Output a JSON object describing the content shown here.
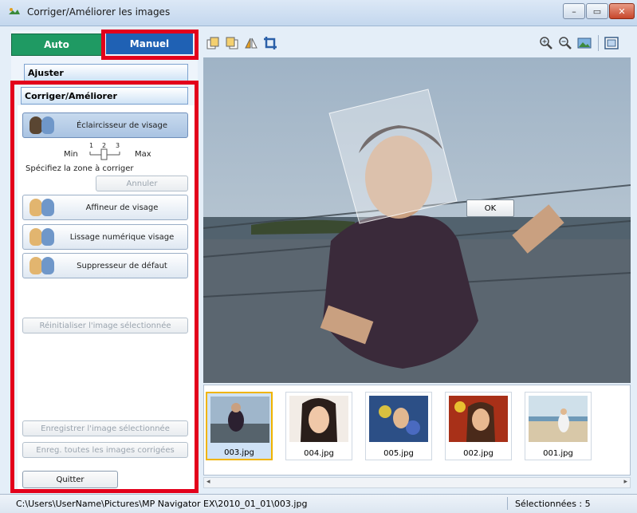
{
  "window": {
    "title": "Corriger/Améliorer les images",
    "controls": [
      "–",
      "▭",
      "✕"
    ]
  },
  "mode_tabs": {
    "auto": "Auto",
    "manual": "Manuel"
  },
  "sections": {
    "adjust": "Ajuster",
    "correct": "Corriger/Améliorer"
  },
  "tools": {
    "face_brightener": "Éclaircisseur de visage",
    "slider_min": "Min",
    "slider_max": "Max",
    "slider_ticks": [
      "1",
      "2",
      "3"
    ],
    "slider_value": 2,
    "specify_area": "Spécifiez la zone à corriger",
    "cancel": "Annuler",
    "face_sharpener": "Affineur de visage",
    "digital_face_smoothing": "Lissage numérique visage",
    "blemish_remover": "Suppresseur de défaut",
    "reset_selected": "Réinitialiser l'image sélectionnée",
    "save_selected": "Enregistrer l'image sélectionnée",
    "save_all": "Enreg. toutes les images corrigées",
    "quit": "Quitter"
  },
  "toolbar": {
    "left_icons": [
      "rotate-left-icon",
      "rotate-right-icon",
      "mirror-icon",
      "crop-icon"
    ],
    "right_icons": [
      "zoom-in-icon",
      "zoom-out-icon",
      "fit-image-icon",
      "full-screen-icon"
    ]
  },
  "preview": {
    "ok_label": "OK"
  },
  "thumbnails": [
    {
      "name": "003.jpg",
      "selected": true
    },
    {
      "name": "004.jpg",
      "selected": false
    },
    {
      "name": "005.jpg",
      "selected": false
    },
    {
      "name": "002.jpg",
      "selected": false
    },
    {
      "name": "001.jpg",
      "selected": false
    }
  ],
  "status": {
    "path": "C:\\Users\\UserName\\Pictures\\MP Navigator EX\\2010_01_01\\003.jpg",
    "selected": "Sélectionnées : 5"
  },
  "colors": {
    "highlight": "#e3001b",
    "auto_tab": "#1f9a63",
    "manual_tab": "#1f61b4",
    "selected_thumb_border": "#f0b400"
  }
}
